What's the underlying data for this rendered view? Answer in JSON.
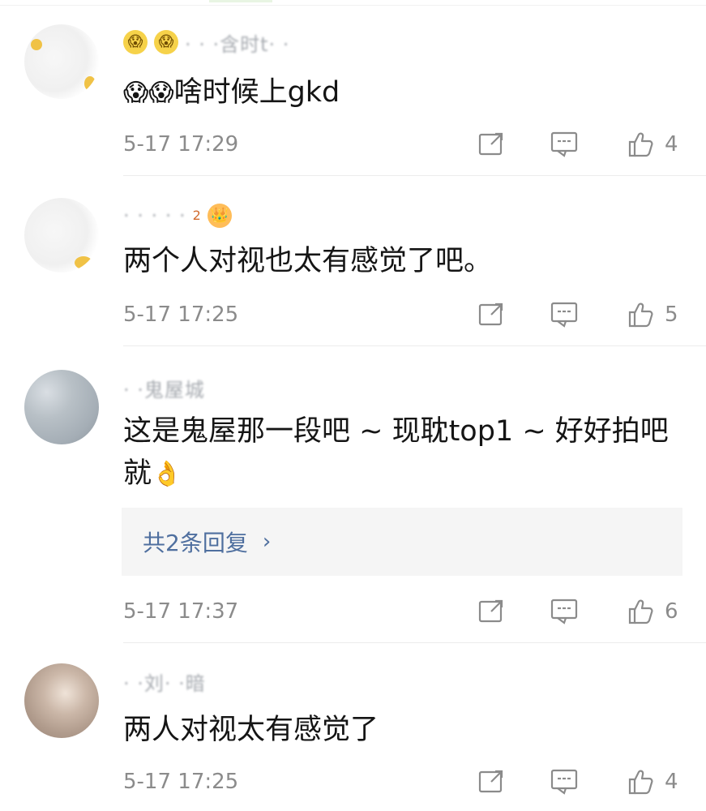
{
  "comments": [
    {
      "username": "· · ·含时t· ·",
      "text": "啥时候上gkd",
      "emojis": [
        "😱",
        "😱"
      ],
      "timestamp": "5-17 17:29",
      "likes": "4",
      "icons": {
        "badge1": "😱",
        "badge2": "😱"
      }
    },
    {
      "username": "· ·  · · ·",
      "level": "2",
      "text": "两个人对视也太有感觉了吧。",
      "timestamp": "5-17 17:25",
      "likes": "5",
      "icons": {
        "badge1": "💛",
        "badge2": "👑"
      }
    },
    {
      "username": "· ·鬼屋城",
      "text": "这是鬼屋那一段吧 ~  现耽top1 ~ 好好拍吧就",
      "emoji_end": "👌",
      "reply_label": "共2条回复",
      "reply_arrow": "›",
      "timestamp": "5-17 17:37",
      "likes": "6"
    },
    {
      "username": "· ·刘· ·暗",
      "text": "两人对视太有感觉了",
      "timestamp": "5-17 17:25",
      "likes": "4"
    }
  ],
  "colors": {
    "timestamp": "#8b8b8b",
    "text": "#151515",
    "reply": "#4f6f9f",
    "divider": "#ececec"
  }
}
